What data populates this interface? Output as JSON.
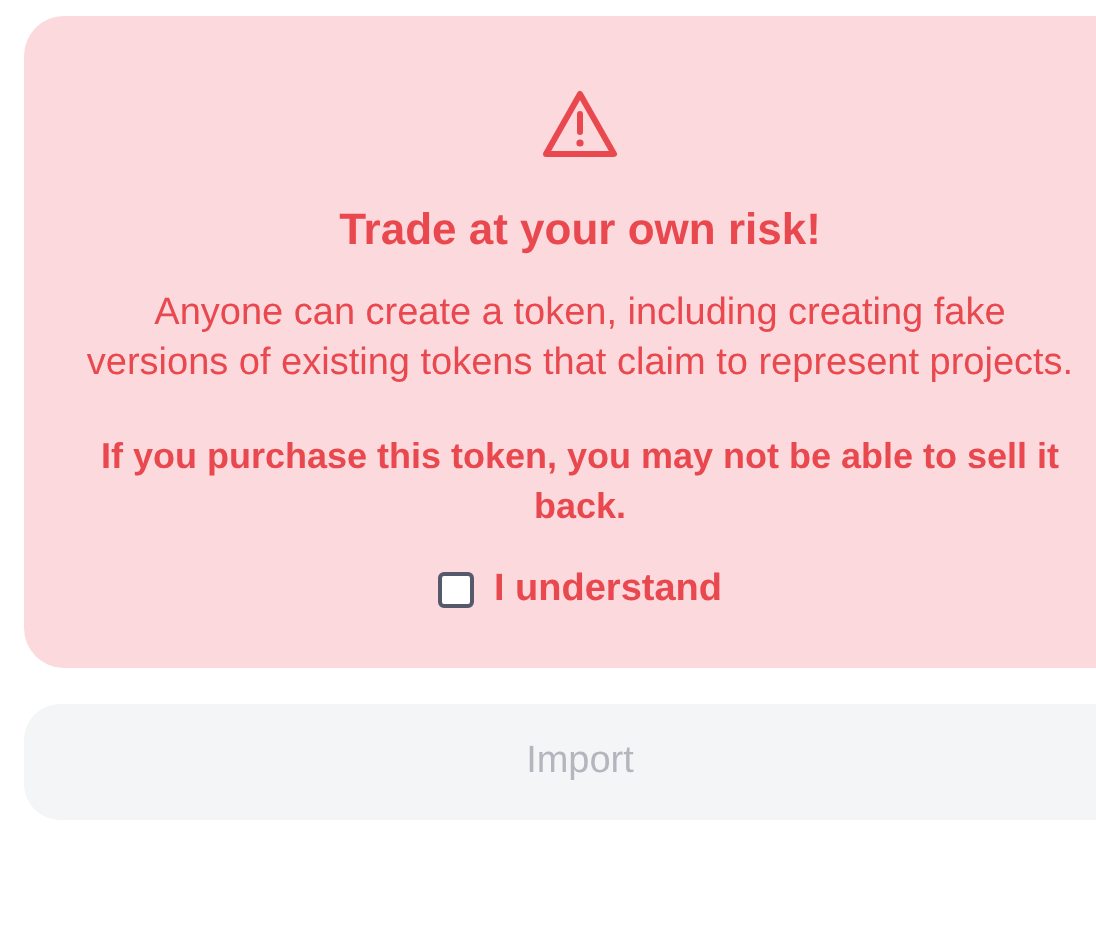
{
  "warning": {
    "title": "Trade at your own risk!",
    "message": "Anyone can create a token, including creating fake versions of existing tokens that claim to represent projects.",
    "emphasis": "If you purchase this token, you may not be able to sell it back.",
    "acknowledge": {
      "label": "I understand",
      "checked": false
    }
  },
  "import_button": {
    "label": "Import",
    "disabled": true
  }
}
